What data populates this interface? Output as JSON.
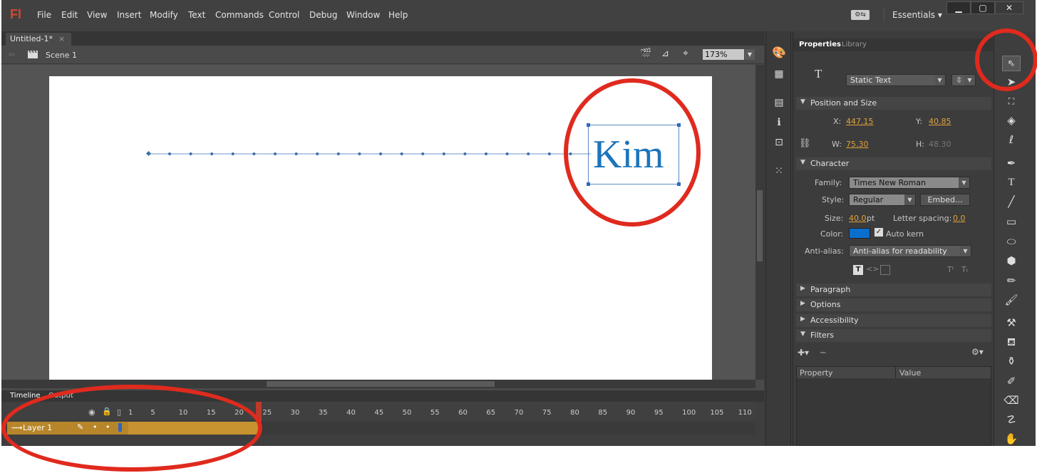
{
  "app": {
    "logo": "Fl"
  },
  "menu": [
    "File",
    "Edit",
    "View",
    "Insert",
    "Modify",
    "Text",
    "Commands",
    "Control",
    "Debug",
    "Window",
    "Help"
  ],
  "workspace": {
    "icon_text": "⚙⇆",
    "label": "Essentials",
    "caret": "▾"
  },
  "window_controls": {
    "minimize": "▁",
    "maximize": "▢",
    "close": "✕"
  },
  "document": {
    "tab_title": "Untitled-1*",
    "tab_close": "×",
    "scene": "Scene 1",
    "zoom": "173%"
  },
  "stage_text": {
    "content": "Kim",
    "color": "#1b75bc"
  },
  "timeline": {
    "tabs": [
      "Timeline",
      "Output"
    ],
    "frame_numbers": [
      "1",
      "5",
      "10",
      "15",
      "20",
      "25",
      "30",
      "35",
      "40",
      "45",
      "50",
      "55",
      "60",
      "65",
      "70",
      "75",
      "80",
      "85",
      "90",
      "95",
      "100",
      "105",
      "110"
    ],
    "layer_name": "Layer 1",
    "icons": {
      "eye": "👁",
      "lock": "🔒",
      "outline": "▯"
    }
  },
  "properties": {
    "tabs": [
      "Properties",
      "Library"
    ],
    "text_icon": "T",
    "text_type": "Static Text",
    "sections": {
      "position_size": "Position and Size",
      "character": "Character",
      "paragraph": "Paragraph",
      "options": "Options",
      "accessibility": "Accessibility",
      "filters": "Filters"
    },
    "x_label": "X:",
    "x": "447.15",
    "y_label": "Y:",
    "y": "40.85",
    "w_label": "W:",
    "w": "75.30",
    "h_label": "H:",
    "h": "48.30",
    "family_label": "Family:",
    "family": "Times New Roman",
    "style_label": "Style:",
    "style": "Regular",
    "embed_label": "Embed...",
    "size_label": "Size:",
    "size": "40.0",
    "size_unit": "pt",
    "letter_spacing_label": "Letter spacing:",
    "letter_spacing": "0.0",
    "color_label": "Color:",
    "color": "#0a6fcc",
    "auto_kern": "Auto kern",
    "antialias_label": "Anti-alias:",
    "antialias": "Anti-alias for readability",
    "filters_columns": [
      "Property",
      "Value"
    ]
  }
}
